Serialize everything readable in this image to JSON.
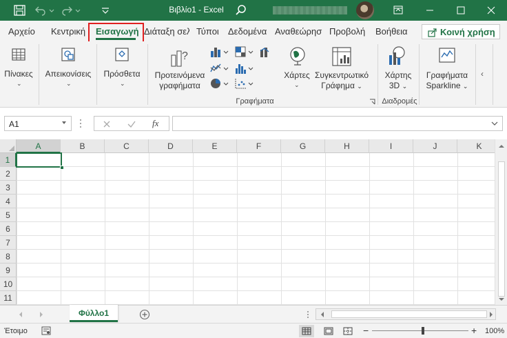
{
  "window": {
    "title": "Βιβλίο1  -  Excel",
    "brand_color": "#217346"
  },
  "ribbon_tabs": [
    {
      "label": "Αρχείο"
    },
    {
      "label": "Κεντρική"
    },
    {
      "label": "Εισαγωγή",
      "active": true
    },
    {
      "label": "Διάταξη σελ"
    },
    {
      "label": "Τύποι"
    },
    {
      "label": "Δεδομένα"
    },
    {
      "label": "Αναθεώρηση"
    },
    {
      "label": "Προβολή"
    },
    {
      "label": "Βοήθεια"
    }
  ],
  "share_label": "Κοινή χρήση",
  "ribbon": {
    "tables": "Πίνακες",
    "illustrations": "Απεικονίσεις",
    "addins": "Πρόσθετα",
    "recommended_charts_line1": "Προτεινόμενα",
    "recommended_charts_line2": "γραφήματα",
    "maps": "Χάρτες",
    "pivot_chart_line1": "Συγκεντρωτικό",
    "pivot_chart_line2": "Γράφημα",
    "map3d_line1": "Χάρτης",
    "map3d_line2": "3D",
    "sparklines_line1": "Γραφήματα",
    "sparklines_line2": "Sparkline",
    "group_charts": "Γραφήματα",
    "group_tours": "Διαδρομές"
  },
  "formula_bar": {
    "name_box": "A1",
    "fx": "fx",
    "formula": ""
  },
  "grid": {
    "columns": [
      "A",
      "B",
      "C",
      "D",
      "E",
      "F",
      "G",
      "H",
      "I",
      "J",
      "K"
    ],
    "rows": [
      "1",
      "2",
      "3",
      "4",
      "5",
      "6",
      "7",
      "8",
      "9",
      "10",
      "11"
    ],
    "active_cell": "A1"
  },
  "sheets": [
    {
      "name": "Φύλλο1",
      "active": true
    }
  ],
  "status": {
    "ready": "Έτοιμο",
    "zoom": "100%"
  }
}
